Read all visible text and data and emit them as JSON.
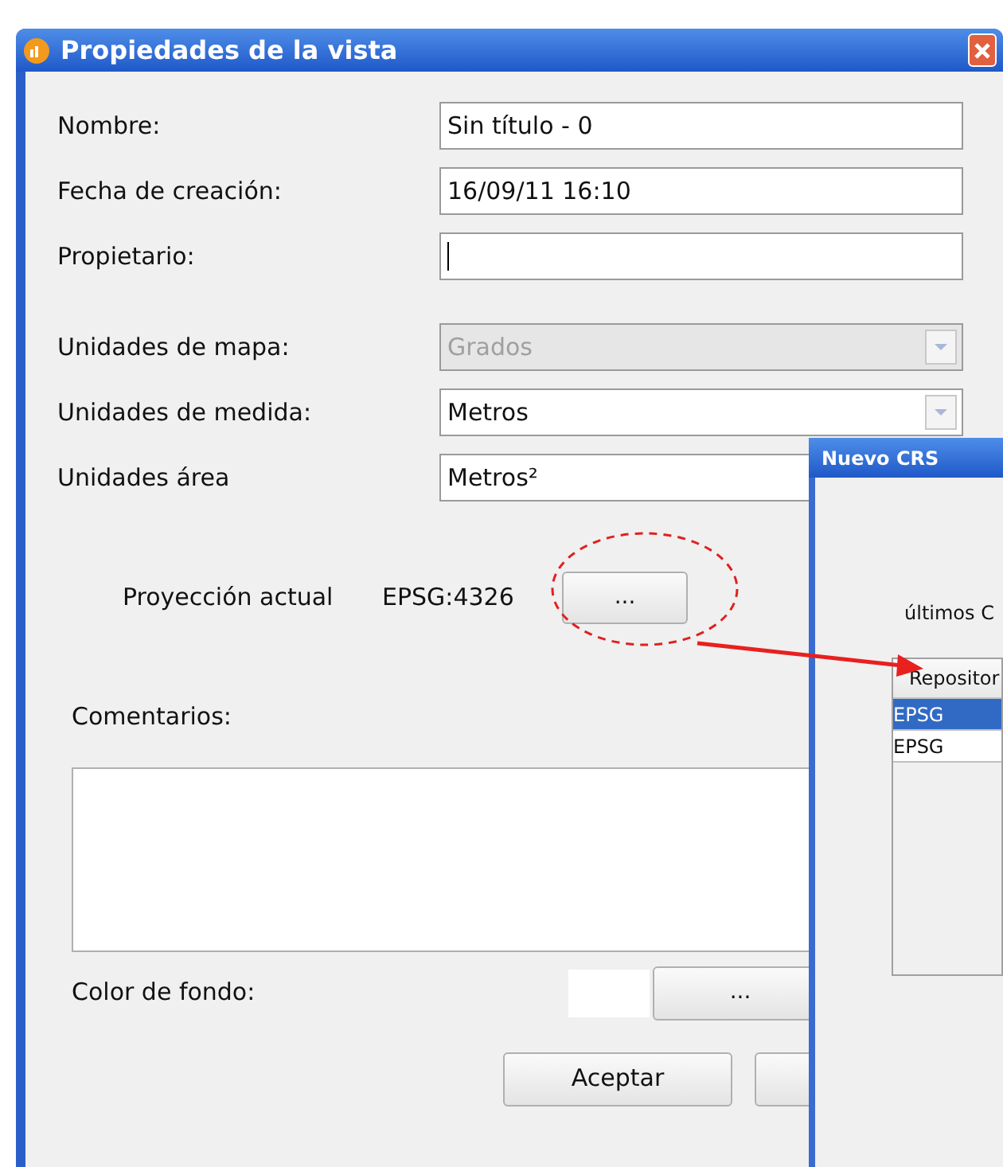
{
  "window": {
    "title": "Propiedades de la vista"
  },
  "fields": [
    {
      "label": "Nombre:",
      "kind": "text",
      "value": "Sin título - 0"
    },
    {
      "label": "Fecha de creación:",
      "kind": "text",
      "value": "16/09/11 16:10"
    },
    {
      "label": "Propietario:",
      "kind": "text",
      "focused": true
    },
    {
      "label": "Unidades de mapa:",
      "kind": "combo",
      "value": "Grados",
      "disabled": true
    },
    {
      "label": "Unidades de medida:",
      "kind": "combo",
      "value": "Metros",
      "disabled": false
    },
    {
      "label": "Unidades área",
      "kind": "combo",
      "value": "Metros²",
      "disabled": false
    }
  ],
  "projection": {
    "label": "Proyección actual",
    "value": "EPSG:4326",
    "button": "..."
  },
  "comments": {
    "label": "Comentarios:"
  },
  "background_color": {
    "label": "Color de fondo:",
    "button": "..."
  },
  "buttons": [
    {
      "label": "Aceptar"
    }
  ],
  "overlay_window": {
    "title": "Nuevo CRS",
    "text": "últimos C",
    "table": {
      "columns": [
        "Repositor"
      ],
      "rows": [
        {
          "cells": [
            "EPSG"
          ],
          "selected": true
        },
        {
          "cells": [
            "EPSG"
          ],
          "selected": false
        }
      ]
    }
  }
}
